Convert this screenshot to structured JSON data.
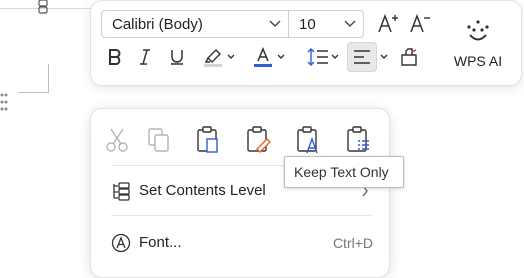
{
  "toolbar": {
    "font_name": "Calibri (Body)",
    "font_size": "10",
    "ai_label": "WPS AI",
    "colors": {
      "highlight": "#d4d4d4",
      "font_color": "#2f5bd6",
      "accent": "#2f5bd6"
    }
  },
  "paste_options": {
    "icons": [
      "cut-icon",
      "copy-icon",
      "paste-keep-formatting-icon",
      "paste-merge-formatting-icon",
      "paste-keep-text-only-icon",
      "paste-list-icon"
    ]
  },
  "context_menu": {
    "items": [
      {
        "label": "Set Contents Level",
        "icon": "contents-level-icon"
      },
      {
        "label": "Font...",
        "icon": "font-icon",
        "shortcut": "Ctrl+D"
      }
    ]
  },
  "tooltip": {
    "text": "Keep Text Only"
  }
}
